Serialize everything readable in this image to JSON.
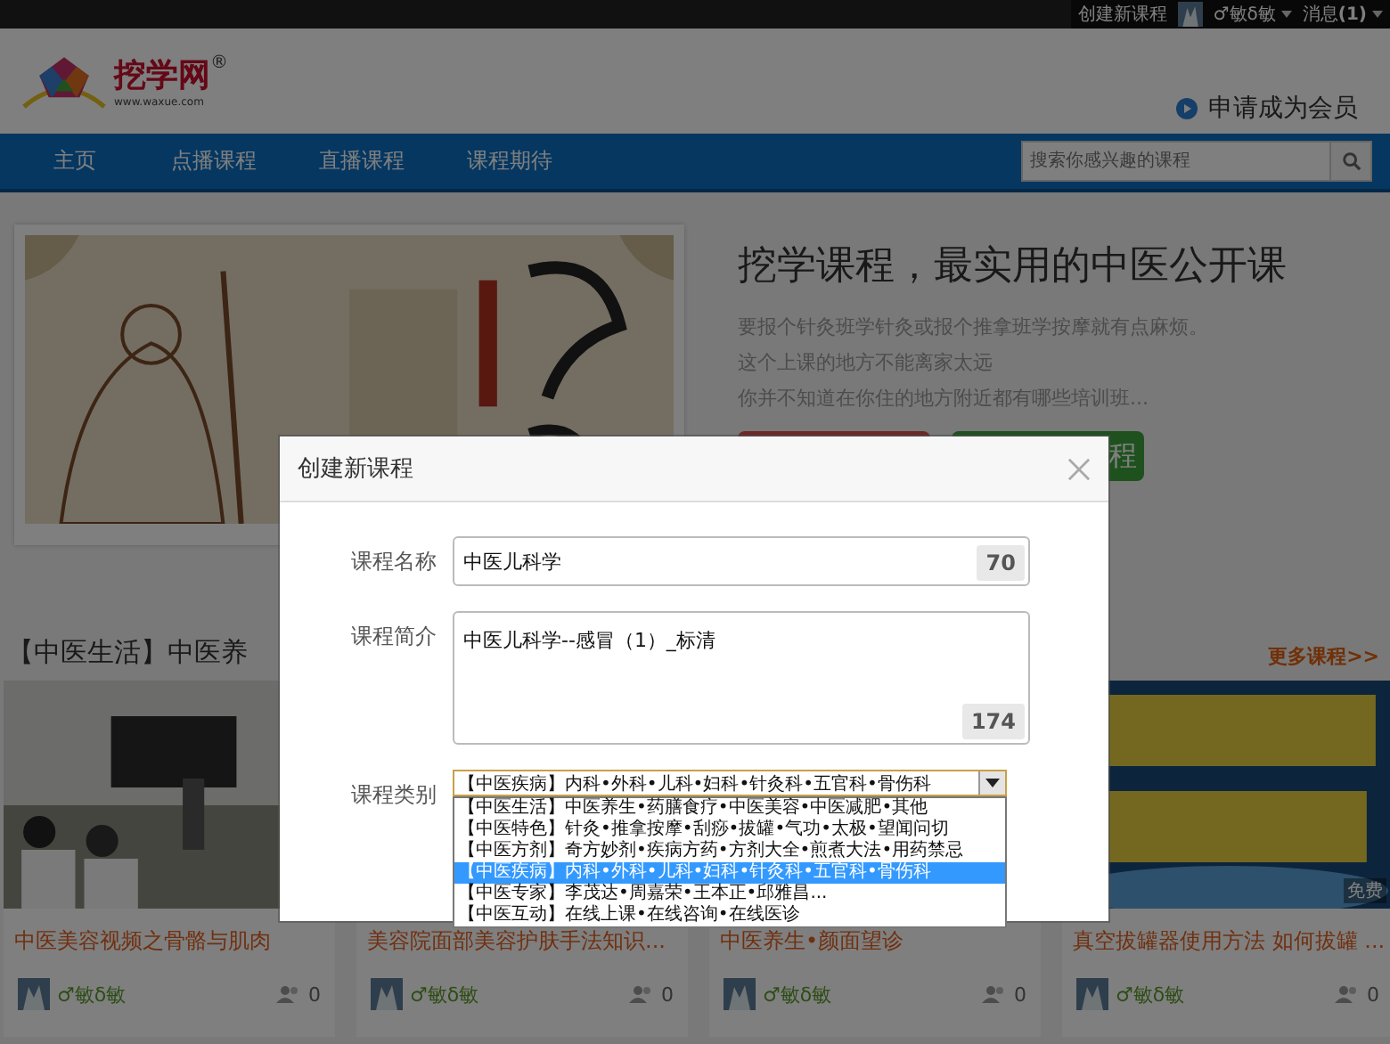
{
  "top_bar": {
    "create_link": "创建新课程",
    "username": "♂敏δ敏",
    "messages": "消息**(1)**"
  },
  "header": {
    "logo_name": "挖学网",
    "logo_mark": "®",
    "logo_url": "www.waxue.com",
    "member_link": "申请成为会员"
  },
  "nav": {
    "items": [
      {
        "label": "主页"
      },
      {
        "label": "点播课程"
      },
      {
        "label": "直播课程"
      },
      {
        "label": "课程期待"
      }
    ],
    "search": {
      "placeholder": "搜索你感兴趣的课程"
    }
  },
  "hero": {
    "title": "挖学课程，最实用的中医公开课",
    "lines": [
      "要报个针灸班学针灸或报个推拿班学按摩就有点麻烦。",
      "这个上课的地方不能离家太远",
      "你并不知道在你住的地方附近都有哪些培训班..."
    ],
    "buttons": [
      {
        "kind": "red"
      },
      {
        "kind": "green",
        "label": "程"
      }
    ]
  },
  "section": {
    "title": "【中医生活】中医养",
    "more_link": "更多课程>>"
  },
  "courses": [
    {
      "kind": "picture",
      "title": "中医美容视频之骨骼与肌肉",
      "author": "♂敏δ敏",
      "students": "0"
    },
    {
      "title": "美容院面部美容护肤手法知识...",
      "author": "♂敏δ敏",
      "students": "0"
    },
    {
      "title": "中医养生•颜面望诊",
      "author": "♂敏δ敏",
      "students": "0"
    },
    {
      "kind": "picture",
      "title": "真空拔罐器使用方法 如何拔罐 ...",
      "author": "♂敏δ敏",
      "students": "0",
      "badge": "免费"
    }
  ],
  "dialog": {
    "title": "创建新课程",
    "fields": [
      {
        "kind": "text",
        "label": "课程名称",
        "value": "中医儿科学",
        "counter": "70"
      },
      {
        "kind": "textarea",
        "label": "课程简介",
        "value": "中医儿科学--感冒（1）_标清",
        "counter": "174"
      },
      {
        "kind": "select",
        "label": "课程类别",
        "value": "【中医疾病】内科•外科•儿科•妇科•针灸科•五官科•骨伤科",
        "expanded": true,
        "options": [
          {
            "label": "【中医生活】中医养生•药膳食疗•中医美容•中医减肥•其他",
            "selected": false
          },
          {
            "label": "【中医特色】针灸•推拿按摩•刮痧•拔罐•气功•太极•望闻问切",
            "selected": false
          },
          {
            "label": "【中医方剂】奇方妙剂•疾病方药•方剂大全•煎煮大法•用药禁忌",
            "selected": false
          },
          {
            "label": "【中医疾病】内科•外科•儿科•妇科•针灸科•五官科•骨伤科",
            "selected": true
          },
          {
            "label": "【中医专家】李茂达•周嘉荣•王本正•邱雅昌...",
            "selected": false
          },
          {
            "label": "【中医互动】在线上课•在线咨询•在线医诊",
            "selected": false
          }
        ]
      }
    ]
  }
}
